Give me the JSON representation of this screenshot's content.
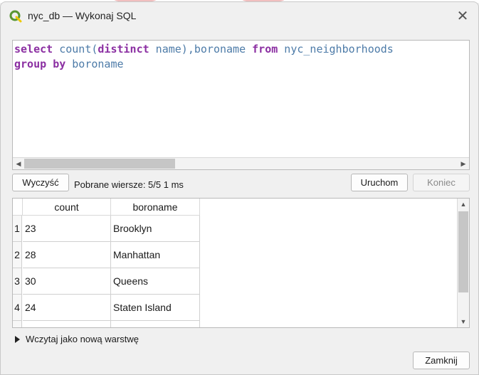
{
  "window": {
    "title": "nyc_db — Wykonaj SQL",
    "close_icon": "close-icon",
    "accent_color": "#589632"
  },
  "editor": {
    "line1": {
      "kw_select": "select",
      "fn_count": "count(",
      "kw_distinct": "distinct",
      "id_name": " name),boroname ",
      "kw_from": "from",
      "id_table": " nyc_neighborhoods"
    },
    "line2": {
      "kw_group": "group",
      "kw_by": "by",
      "id_col": " boroname"
    }
  },
  "toolbar": {
    "clear_label": "Wyczyść",
    "status_text": "Pobrane wiersze: 5/5  1 ms",
    "run_label": "Uruchom",
    "stop_label": "Koniec"
  },
  "results": {
    "columns": [
      "count",
      "boroname"
    ],
    "rows": [
      {
        "num": "1",
        "count": "23",
        "boroname": "Brooklyn"
      },
      {
        "num": "2",
        "count": "28",
        "boroname": "Manhattan"
      },
      {
        "num": "3",
        "count": "30",
        "boroname": "Queens"
      },
      {
        "num": "4",
        "count": "24",
        "boroname": "Staten Island"
      }
    ]
  },
  "load_layer": {
    "label": "Wczytaj jako nową warstwę",
    "expander_icon": "triangle-right-icon"
  },
  "footer": {
    "close_label": "Zamknij"
  }
}
